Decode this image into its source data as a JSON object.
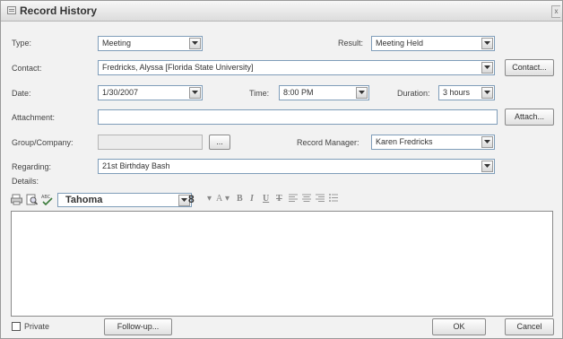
{
  "window": {
    "title": "Record History",
    "close_label": "x"
  },
  "form": {
    "type": {
      "label": "Type:",
      "value": "Meeting"
    },
    "result": {
      "label": "Result:",
      "value": "Meeting Held"
    },
    "contact": {
      "label": "Contact:",
      "value": "Fredricks, Alyssa [Florida State University]",
      "button": "Contact..."
    },
    "date": {
      "label": "Date:",
      "value": "1/30/2007"
    },
    "time": {
      "label": "Time:",
      "value": "8:00 PM"
    },
    "duration": {
      "label": "Duration:",
      "value": "3 hours"
    },
    "attachment": {
      "label": "Attachment:",
      "value": "",
      "button": "Attach..."
    },
    "group_company": {
      "label": "Group/Company:",
      "value": "",
      "button": "..."
    },
    "record_manager": {
      "label": "Record Manager:",
      "value": "Karen Fredricks"
    },
    "regarding": {
      "label": "Regarding:",
      "value": "21st Birthday Bash"
    },
    "details": {
      "label": "Details:"
    }
  },
  "toolbar": {
    "font_name": "Tahoma",
    "font_size": "8",
    "icons": [
      "print-icon",
      "preview-icon",
      "spellcheck-icon",
      "font-color-icon",
      "bold-icon",
      "italic-icon",
      "underline-icon",
      "strikethrough-icon",
      "align-left-icon",
      "align-center-icon",
      "align-right-icon",
      "bullets-icon"
    ]
  },
  "footer": {
    "private_label": "Private",
    "followup_button": "Follow-up...",
    "ok_button": "OK",
    "cancel_button": "Cancel"
  }
}
